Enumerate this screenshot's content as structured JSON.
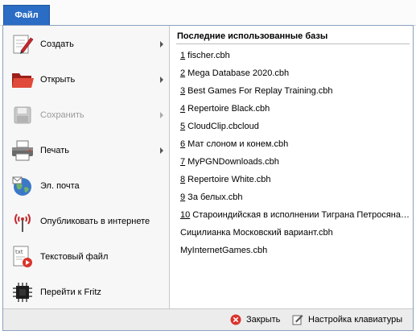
{
  "tab": {
    "label": "Файл"
  },
  "menu": {
    "items": [
      {
        "label": "Создать",
        "icon": "new-pencil-icon",
        "has_submenu": true,
        "disabled": false
      },
      {
        "label": "Открыть",
        "icon": "folder-open-icon",
        "has_submenu": true,
        "disabled": false
      },
      {
        "label": "Сохранить",
        "icon": "floppy-disk-icon",
        "has_submenu": true,
        "disabled": true
      },
      {
        "label": "Печать",
        "icon": "printer-icon",
        "has_submenu": true,
        "disabled": false
      },
      {
        "label": "Эл. почта",
        "icon": "globe-mail-icon",
        "has_submenu": false,
        "disabled": false
      },
      {
        "label": "Опубликовать в интернете",
        "icon": "broadcast-tower-icon",
        "has_submenu": false,
        "disabled": false
      },
      {
        "label": "Текстовый файл",
        "icon": "txt-file-icon",
        "has_submenu": false,
        "disabled": false
      },
      {
        "label": "Перейти к Fritz",
        "icon": "chip-icon",
        "has_submenu": false,
        "disabled": false
      }
    ]
  },
  "recent": {
    "header": "Последние использованные базы",
    "items": [
      {
        "num": "1",
        "text": " fischer.cbh"
      },
      {
        "num": "2",
        "text": " Mega Database 2020.cbh"
      },
      {
        "num": "3",
        "text": " Best Games For Replay Training.cbh"
      },
      {
        "num": "4",
        "text": " Repertoire Black.cbh"
      },
      {
        "num": "5",
        "text": " CloudClip.cbcloud"
      },
      {
        "num": "6",
        "text": " Мат слоном и конем.cbh"
      },
      {
        "num": "7",
        "text": " MyPGNDownloads.cbh"
      },
      {
        "num": "8",
        "text": " Repertoire White.cbh"
      },
      {
        "num": "9",
        "text": " За белых.cbh"
      },
      {
        "num": "10",
        "text": " Староиндийская в исполнении Тиграна Петросяна.cbh"
      },
      {
        "num": "",
        "text": "Сицилианка Московский вариант.cbh"
      },
      {
        "num": "",
        "text": "MyInternetGames.cbh"
      }
    ]
  },
  "status": {
    "close_label": "Закрыть",
    "keyboard_label": "Настройка клавиатуры"
  },
  "colors": {
    "tab_blue": "#2b6cc4",
    "folder_red": "#d23c2c",
    "close_red": "#d9332b"
  }
}
